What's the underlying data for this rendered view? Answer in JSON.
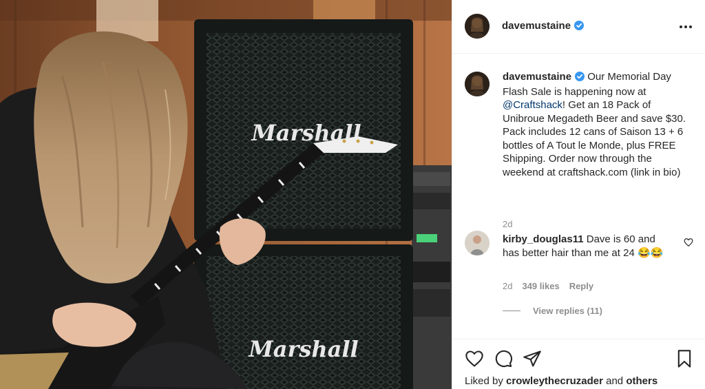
{
  "post": {
    "username": "davemustaine",
    "verified": true,
    "more_icon": "more-options-icon"
  },
  "media": {
    "amp_brand_top": "Marshall",
    "amp_brand_bottom": "Marshall"
  },
  "caption": {
    "username": "davemustaine",
    "text_before": " Our Memorial Day Flash Sale is happening now at ",
    "mention": "@Craftshack",
    "text_after": "! Get an 18 Pack of Unibroue Megadeth Beer and save $30. Pack includes 12 cans of Saison 13 + 6 bottles of A Tout le Monde, plus FREE Shipping. Order now through the weekend at craftshack.com (link in bio)",
    "time": "2d"
  },
  "comment": {
    "username": "kirby_douglas11",
    "text": " Dave is 60 and has better hair than me at 24 😂😂",
    "time": "2d",
    "likes": "349 likes",
    "reply_label": "Reply",
    "view_replies": "View replies (11)"
  },
  "actions": {
    "like_icon": "heart-icon",
    "comment_icon": "comment-icon",
    "share_icon": "share-icon",
    "save_icon": "bookmark-icon"
  },
  "liked_by": {
    "prefix": "Liked by ",
    "user": "crowleythecruzader",
    "joiner": " and ",
    "others": "others"
  },
  "colors": {
    "link": "#00376b",
    "verified": "#3897f0",
    "muted": "#8e8e8e",
    "text": "#262626"
  }
}
